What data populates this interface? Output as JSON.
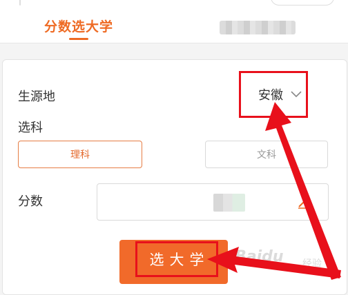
{
  "tabs": {
    "active_label": "分数选大学"
  },
  "form": {
    "province_label": "生源地",
    "province_value": "安徽",
    "subject_label": "选科",
    "subject_options": [
      "理科",
      "文科"
    ],
    "subject_selected": "理科",
    "score_label": "分数",
    "submit_label": "选大学"
  },
  "watermark": {
    "text": "Baidu",
    "sub": "经验"
  },
  "colors": {
    "accent": "#ee6a23",
    "annotation": "#e8101b",
    "button": "#f16a2a"
  },
  "icons": [
    "chevron-down-icon",
    "pencil-icon",
    "annotation-arrow"
  ]
}
